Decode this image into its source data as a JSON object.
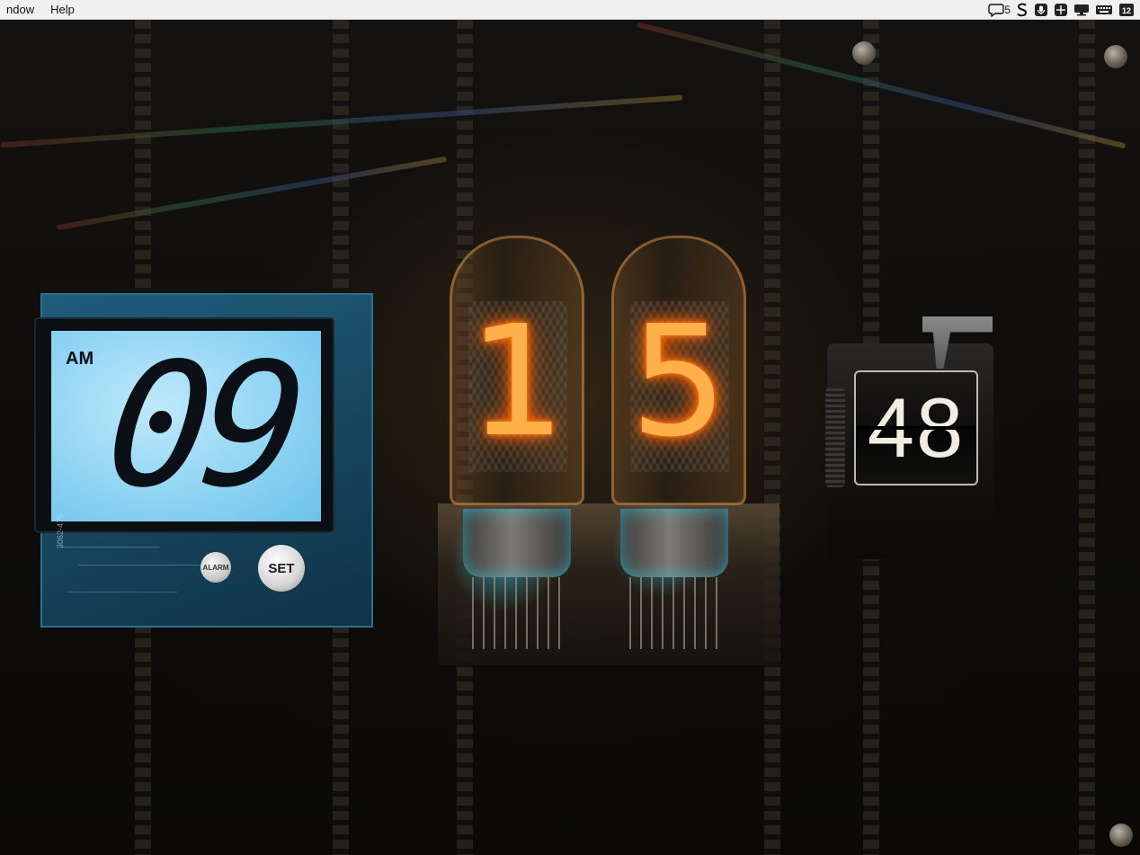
{
  "menubar": {
    "items": [
      "ndow",
      "Help"
    ],
    "status": {
      "notification_count": "5",
      "date_badge": "12"
    }
  },
  "clock": {
    "lcd": {
      "meridiem": "AM",
      "hour": "09",
      "buttons": {
        "alarm": "ALARM",
        "set": "SET"
      },
      "board_label": "3062-475"
    },
    "nixie": {
      "digits": [
        "1",
        "5"
      ]
    },
    "flip": {
      "seconds": "48"
    },
    "colors": {
      "lcd_background": "#8fd4f3",
      "nixie_glow": "#ff7a1a",
      "flip_card": "#0f0e0d"
    }
  }
}
